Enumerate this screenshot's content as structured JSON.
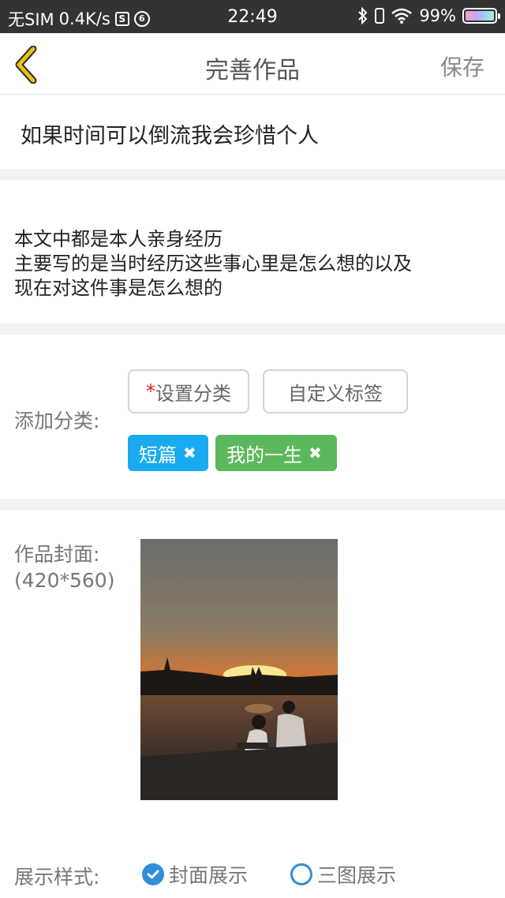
{
  "status_bar": {
    "carrier": "无SIM",
    "speed": "0.4K/s",
    "icon_box_letter": "S",
    "icon_circle_letter": "6",
    "time": "22:49",
    "battery": "99%",
    "battery_level": 0.99
  },
  "nav": {
    "title": "完善作品",
    "save_label": "保存"
  },
  "work": {
    "title": "如果时间可以倒流我会珍惜个人",
    "description_lines": [
      "本文中都是本人亲身经历",
      "主要写的是当时经历这些事心里是怎么想的以及",
      "现在对这件事是怎么想的"
    ]
  },
  "category": {
    "label": "添加分类:",
    "required_mark": "*",
    "set_category_label": "设置分类",
    "custom_tag_label": "自定义标签",
    "tags": [
      {
        "label": "短篇",
        "color": "#1aaaf0"
      },
      {
        "label": "我的一生",
        "color": "#5cb85c"
      }
    ],
    "remove_glyph": "✖"
  },
  "cover": {
    "label_line1": "作品封面:",
    "label_line2": "(420*560)"
  },
  "display_style": {
    "label": "展示样式:",
    "options": [
      {
        "label": "封面展示",
        "selected": true
      },
      {
        "label": "三图展示",
        "selected": false
      }
    ]
  },
  "colors": {
    "accent": "#2f8fd8",
    "back_arrow": "#e6c21a"
  }
}
